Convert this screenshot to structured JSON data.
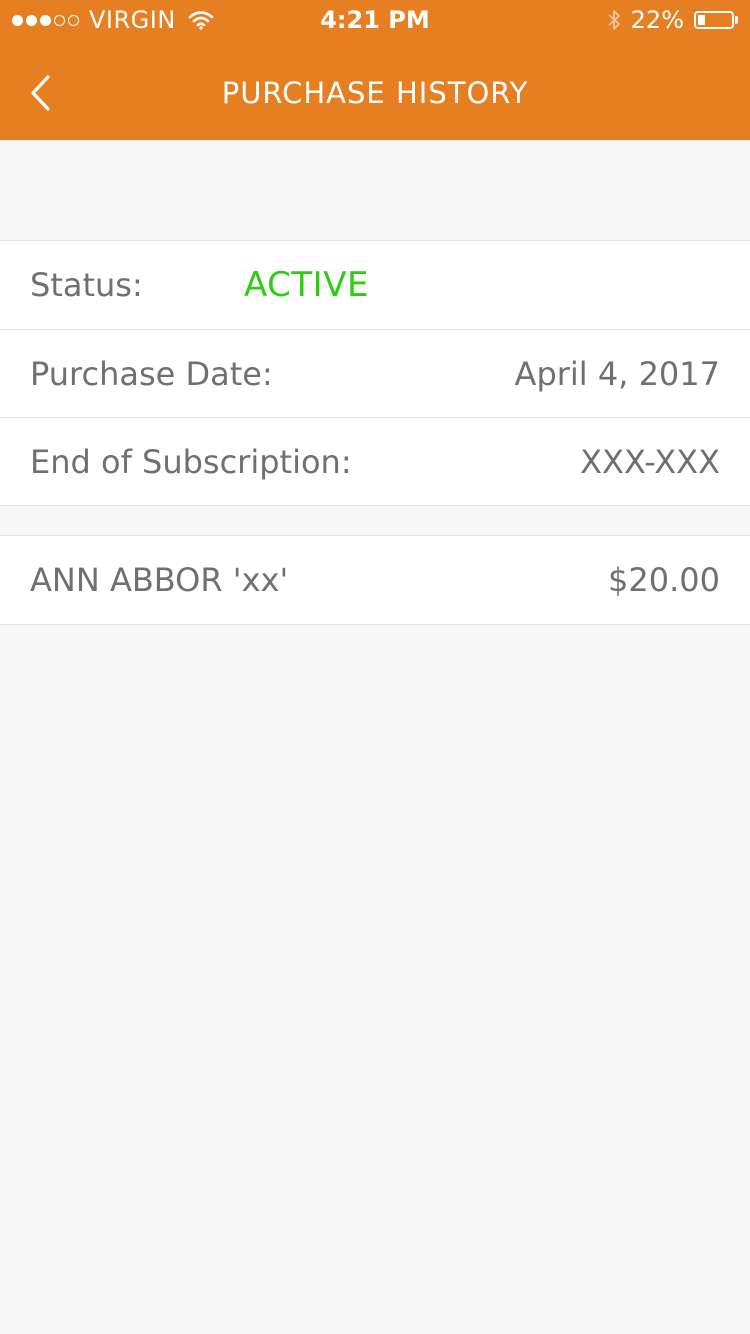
{
  "statusbar": {
    "carrier": "VIRGIN",
    "time": "4:21 PM",
    "battery_text": "22%",
    "battery_level": 0.22,
    "signal_bars_filled": 3,
    "signal_bars_total": 5,
    "icons": [
      "signal-dots-icon",
      "wifi-icon",
      "bluetooth-icon",
      "battery-icon"
    ]
  },
  "navbar": {
    "title": "PURCHASE HISTORY",
    "back_icon": "chevron-left-icon"
  },
  "details": {
    "status_label": "Status:",
    "status_value": "ACTIVE",
    "purchase_date_label": "Purchase Date:",
    "purchase_date_value": "April 4, 2017",
    "end_label": "End of Subscription:",
    "end_value": "XXX-XXX"
  },
  "items": [
    {
      "name": "ANN ABBOR 'xx'",
      "price": "$20.00"
    }
  ],
  "colors": {
    "header": "#e67e22",
    "active_status": "#2ecc14",
    "text": "#707070",
    "background": "#f7f7f7"
  }
}
